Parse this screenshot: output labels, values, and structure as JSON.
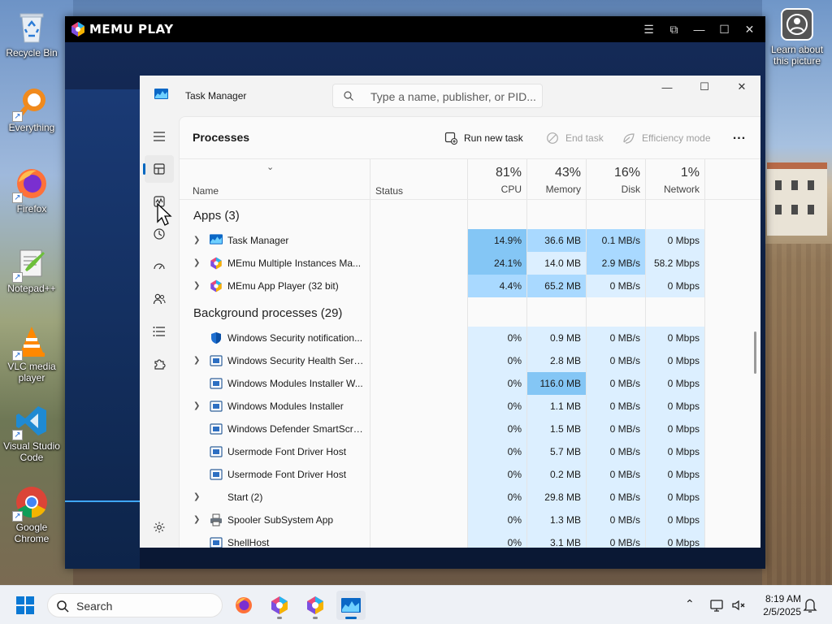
{
  "desktop": {
    "icons": [
      {
        "label": "Recycle Bin",
        "icon": "recycle-bin-icon"
      },
      {
        "label": "Everything",
        "icon": "everything-icon"
      },
      {
        "label": "Firefox",
        "icon": "firefox-icon"
      },
      {
        "label": "Notepad++",
        "icon": "notepadpp-icon"
      },
      {
        "label": "VLC media player",
        "icon": "vlc-icon"
      },
      {
        "label": "Visual Studio Code",
        "icon": "vscode-icon"
      },
      {
        "label": "Google Chrome",
        "icon": "chrome-icon"
      }
    ],
    "learn_picture": "Learn about this picture"
  },
  "memu": {
    "title": "MEMU PLAY",
    "accent": "#3fa7ff"
  },
  "task_manager": {
    "title": "Task Manager",
    "search_placeholder": "Type a name, publisher, or PID...",
    "page_title": "Processes",
    "commands": {
      "run_new_task": "Run new task",
      "end_task": "End task",
      "efficiency_mode": "Efficiency mode",
      "more": "..."
    },
    "columns": {
      "name": "Name",
      "status": "Status",
      "cpu": {
        "pct": "81%",
        "label": "CPU"
      },
      "memory": {
        "pct": "43%",
        "label": "Memory"
      },
      "disk": {
        "pct": "16%",
        "label": "Disk"
      },
      "network": {
        "pct": "1%",
        "label": "Network"
      }
    },
    "apps_header": "Apps (3)",
    "apps": [
      {
        "name": "Task Manager",
        "cpu": "14.9%",
        "memory": "36.6 MB",
        "disk": "0.1 MB/s",
        "network": "0 Mbps",
        "expandable": true,
        "icon": "task-manager-icon"
      },
      {
        "name": "MEmu Multiple Instances Ma...",
        "cpu": "24.1%",
        "memory": "14.0 MB",
        "disk": "2.9 MB/s",
        "network": "58.2 Mbps",
        "expandable": true,
        "icon": "memu-icon"
      },
      {
        "name": "MEmu App Player (32 bit)",
        "cpu": "4.4%",
        "memory": "65.2 MB",
        "disk": "0 MB/s",
        "network": "0 Mbps",
        "expandable": true,
        "icon": "memu-icon"
      }
    ],
    "bg_header": "Background processes (29)",
    "background": [
      {
        "name": "Windows Security notification...",
        "cpu": "0%",
        "memory": "0.9 MB",
        "disk": "0 MB/s",
        "network": "0 Mbps",
        "expandable": false,
        "icon": "shield-icon"
      },
      {
        "name": "Windows Security Health Servi...",
        "cpu": "0%",
        "memory": "2.8 MB",
        "disk": "0 MB/s",
        "network": "0 Mbps",
        "expandable": true,
        "icon": "service-icon"
      },
      {
        "name": "Windows Modules Installer W...",
        "cpu": "0%",
        "memory": "116.0 MB",
        "disk": "0 MB/s",
        "network": "0 Mbps",
        "expandable": false,
        "icon": "service-icon"
      },
      {
        "name": "Windows Modules Installer",
        "cpu": "0%",
        "memory": "1.1 MB",
        "disk": "0 MB/s",
        "network": "0 Mbps",
        "expandable": true,
        "icon": "service-icon"
      },
      {
        "name": "Windows Defender SmartScreen",
        "cpu": "0%",
        "memory": "1.5 MB",
        "disk": "0 MB/s",
        "network": "0 Mbps",
        "expandable": false,
        "icon": "service-icon"
      },
      {
        "name": "Usermode Font Driver Host",
        "cpu": "0%",
        "memory": "5.7 MB",
        "disk": "0 MB/s",
        "network": "0 Mbps",
        "expandable": false,
        "icon": "service-icon"
      },
      {
        "name": "Usermode Font Driver Host",
        "cpu": "0%",
        "memory": "0.2 MB",
        "disk": "0 MB/s",
        "network": "0 Mbps",
        "expandable": false,
        "icon": "service-icon"
      },
      {
        "name": "Start (2)",
        "cpu": "0%",
        "memory": "29.8 MB",
        "disk": "0 MB/s",
        "network": "0 Mbps",
        "expandable": true,
        "icon": ""
      },
      {
        "name": "Spooler SubSystem App",
        "cpu": "0%",
        "memory": "1.3 MB",
        "disk": "0 MB/s",
        "network": "0 Mbps",
        "expandable": true,
        "icon": "printer-icon"
      },
      {
        "name": "ShellHost",
        "cpu": "0%",
        "memory": "3.1 MB",
        "disk": "0 MB/s",
        "network": "0 Mbps",
        "expandable": false,
        "icon": "service-icon"
      }
    ],
    "heat_colors": {
      "light": "#dcefff",
      "medium": "#cde9fc",
      "strong": "#a9d9ff",
      "hot": "#84c6f5"
    }
  },
  "taskbar": {
    "search": "Search",
    "time": "8:19 AM",
    "date": "2/5/2025"
  }
}
